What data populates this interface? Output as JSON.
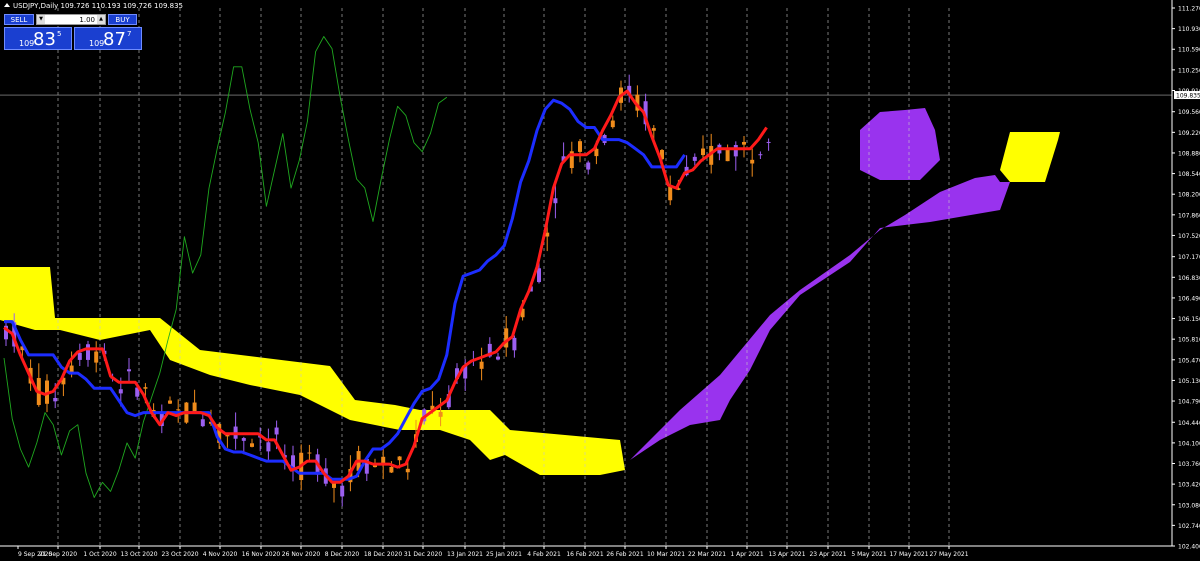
{
  "title": "USDJPY,Daily  109.726 110.193 109.726 109.835",
  "trade_panel": {
    "sell_label": "SELL",
    "buy_label": "BUY",
    "lot": "1.00",
    "sell_quote": {
      "small": "109",
      "big": "83",
      "sup": "5"
    },
    "buy_quote": {
      "small": "109",
      "big": "87",
      "sup": "7"
    }
  },
  "colors": {
    "background": "#000000",
    "tenkan": "#ff1a1a",
    "kijun": "#1c2dff",
    "chikou": "#1fa81f",
    "kumo_bull": "#ffff00",
    "kumo_bear": "#9933ee",
    "candle_up": "#9b5ff0",
    "candle_down": "#f08c1c"
  },
  "chart_data": {
    "type": "line",
    "title": "USDJPY,Daily",
    "price_axis_labels": [
      "111.270",
      "110.930",
      "110.590",
      "110.250",
      "109.910",
      "109.560",
      "109.220",
      "108.880",
      "108.540",
      "108.200",
      "107.860",
      "107.520",
      "107.170",
      "106.830",
      "106.490",
      "106.150",
      "105.810",
      "105.470",
      "105.130",
      "104.790",
      "104.440",
      "104.100",
      "103.760",
      "103.420",
      "103.080",
      "102.740",
      "102.400"
    ],
    "date_axis_labels": [
      "9 Sep 2020",
      "21 Sep 2020",
      "1 Oct 2020",
      "13 Oct 2020",
      "23 Oct 2020",
      "4 Nov 2020",
      "16 Nov 2020",
      "26 Nov 2020",
      "8 Dec 2020",
      "18 Dec 2020",
      "31 Dec 2020",
      "13 Jan 2021",
      "25 Jan 2021",
      "4 Feb 2021",
      "16 Feb 2021",
      "26 Feb 2021",
      "10 Mar 2021",
      "22 Mar 2021",
      "1 Apr 2021",
      "13 Apr 2021",
      "23 Apr 2021",
      "5 May 2021",
      "17 May 2021",
      "27 May 2021"
    ],
    "current_price": "109.835",
    "ylim": [
      102.4,
      111.27
    ],
    "series": [
      {
        "key": "tenkan",
        "values": [
          106.0,
          105.9,
          105.55,
          105.25,
          104.95,
          104.9,
          104.95,
          105.15,
          105.45,
          105.6,
          105.65,
          105.65,
          105.65,
          105.2,
          105.1,
          105.1,
          105.1,
          104.9,
          104.6,
          104.4,
          104.6,
          104.55,
          104.6,
          104.6,
          104.6,
          104.55,
          104.35,
          104.25,
          104.25,
          104.25,
          104.25,
          104.25,
          104.15,
          104.15,
          103.9,
          103.65,
          103.7,
          103.8,
          103.8,
          103.6,
          103.45,
          103.45,
          103.55,
          103.8,
          103.8,
          103.75,
          103.75,
          103.75,
          103.7,
          103.75,
          104.05,
          104.5,
          104.6,
          104.7,
          104.8,
          105.1,
          105.35,
          105.45,
          105.5,
          105.55,
          105.6,
          105.75,
          105.85,
          106.3,
          106.6,
          107.0,
          107.6,
          108.3,
          108.7,
          108.85,
          108.85,
          108.85,
          108.95,
          109.25,
          109.5,
          109.8,
          109.9,
          109.7,
          109.55,
          109.15,
          108.8,
          108.35,
          108.3,
          108.55,
          108.6,
          108.75,
          108.85,
          108.95,
          108.95,
          108.95,
          108.95,
          108.95,
          109.1,
          109.3
        ]
      },
      {
        "key": "kijun",
        "values": [
          106.1,
          106.1,
          105.8,
          105.55,
          105.55,
          105.55,
          105.55,
          105.35,
          105.25,
          105.25,
          105.15,
          105.0,
          105.0,
          105.0,
          104.8,
          104.6,
          104.55,
          104.6,
          104.6,
          104.6,
          104.6,
          104.6,
          104.6,
          104.6,
          104.6,
          104.6,
          104.2,
          104.0,
          103.95,
          103.95,
          103.9,
          103.85,
          103.8,
          103.8,
          103.8,
          103.7,
          103.6,
          103.6,
          103.6,
          103.6,
          103.5,
          103.5,
          103.5,
          103.55,
          103.8,
          104.0,
          104.0,
          104.1,
          104.25,
          104.5,
          104.75,
          104.95,
          105.0,
          105.15,
          105.55,
          106.4,
          106.85,
          106.9,
          106.95,
          107.1,
          107.2,
          107.35,
          107.8,
          108.4,
          108.75,
          109.25,
          109.6,
          109.75,
          109.7,
          109.6,
          109.4,
          109.3,
          109.3,
          109.1,
          109.1,
          109.1,
          109.05,
          108.95,
          108.85,
          108.65,
          108.65,
          108.65,
          108.65,
          108.85
        ]
      },
      {
        "key": "chikou",
        "values": [
          105.5,
          104.5,
          104.0,
          103.7,
          104.1,
          104.6,
          104.4,
          103.9,
          104.3,
          104.4,
          103.6,
          103.2,
          103.45,
          103.3,
          103.65,
          104.1,
          103.85,
          104.45,
          104.85,
          105.25,
          105.8,
          106.3,
          107.5,
          106.9,
          107.2,
          108.3,
          108.95,
          109.55,
          110.3,
          110.3,
          109.6,
          109.05,
          108.0,
          108.6,
          109.2,
          108.3,
          108.75,
          109.4,
          110.55,
          110.8,
          110.6,
          109.8,
          109.1,
          108.45,
          108.3,
          107.75,
          108.45,
          109.1,
          109.65,
          109.5,
          109.05,
          108.9,
          109.2,
          109.7,
          109.8
        ]
      }
    ]
  }
}
